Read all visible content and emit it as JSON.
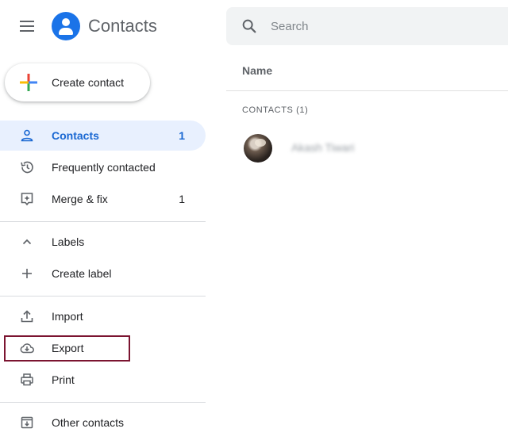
{
  "app": {
    "title": "Contacts"
  },
  "search": {
    "placeholder": "Search"
  },
  "create": {
    "label": "Create contact"
  },
  "sidebar": {
    "items": [
      {
        "label": "Contacts",
        "count": "1",
        "active": true,
        "icon": "person-icon"
      },
      {
        "label": "Frequently contacted",
        "count": "",
        "icon": "history-icon"
      },
      {
        "label": "Merge & fix",
        "count": "1",
        "icon": "merge-fix-icon"
      }
    ],
    "labels_section": {
      "label": "Labels",
      "icon": "chevron-up-icon"
    },
    "create_label": {
      "label": "Create label",
      "icon": "plus-icon"
    },
    "actions": [
      {
        "label": "Import",
        "icon": "upload-icon"
      },
      {
        "label": "Export",
        "icon": "cloud-download-icon"
      },
      {
        "label": "Print",
        "icon": "printer-icon"
      }
    ],
    "other_contacts": {
      "label": "Other contacts",
      "icon": "archive-download-icon"
    }
  },
  "main": {
    "column_header": "Name",
    "section_title": "CONTACTS (1)",
    "contacts": [
      {
        "name": "Akash Tiwari"
      }
    ]
  },
  "colors": {
    "accent": "#1a73e8",
    "active_bg": "#e8f0fe",
    "highlight_border": "#7b1430"
  }
}
